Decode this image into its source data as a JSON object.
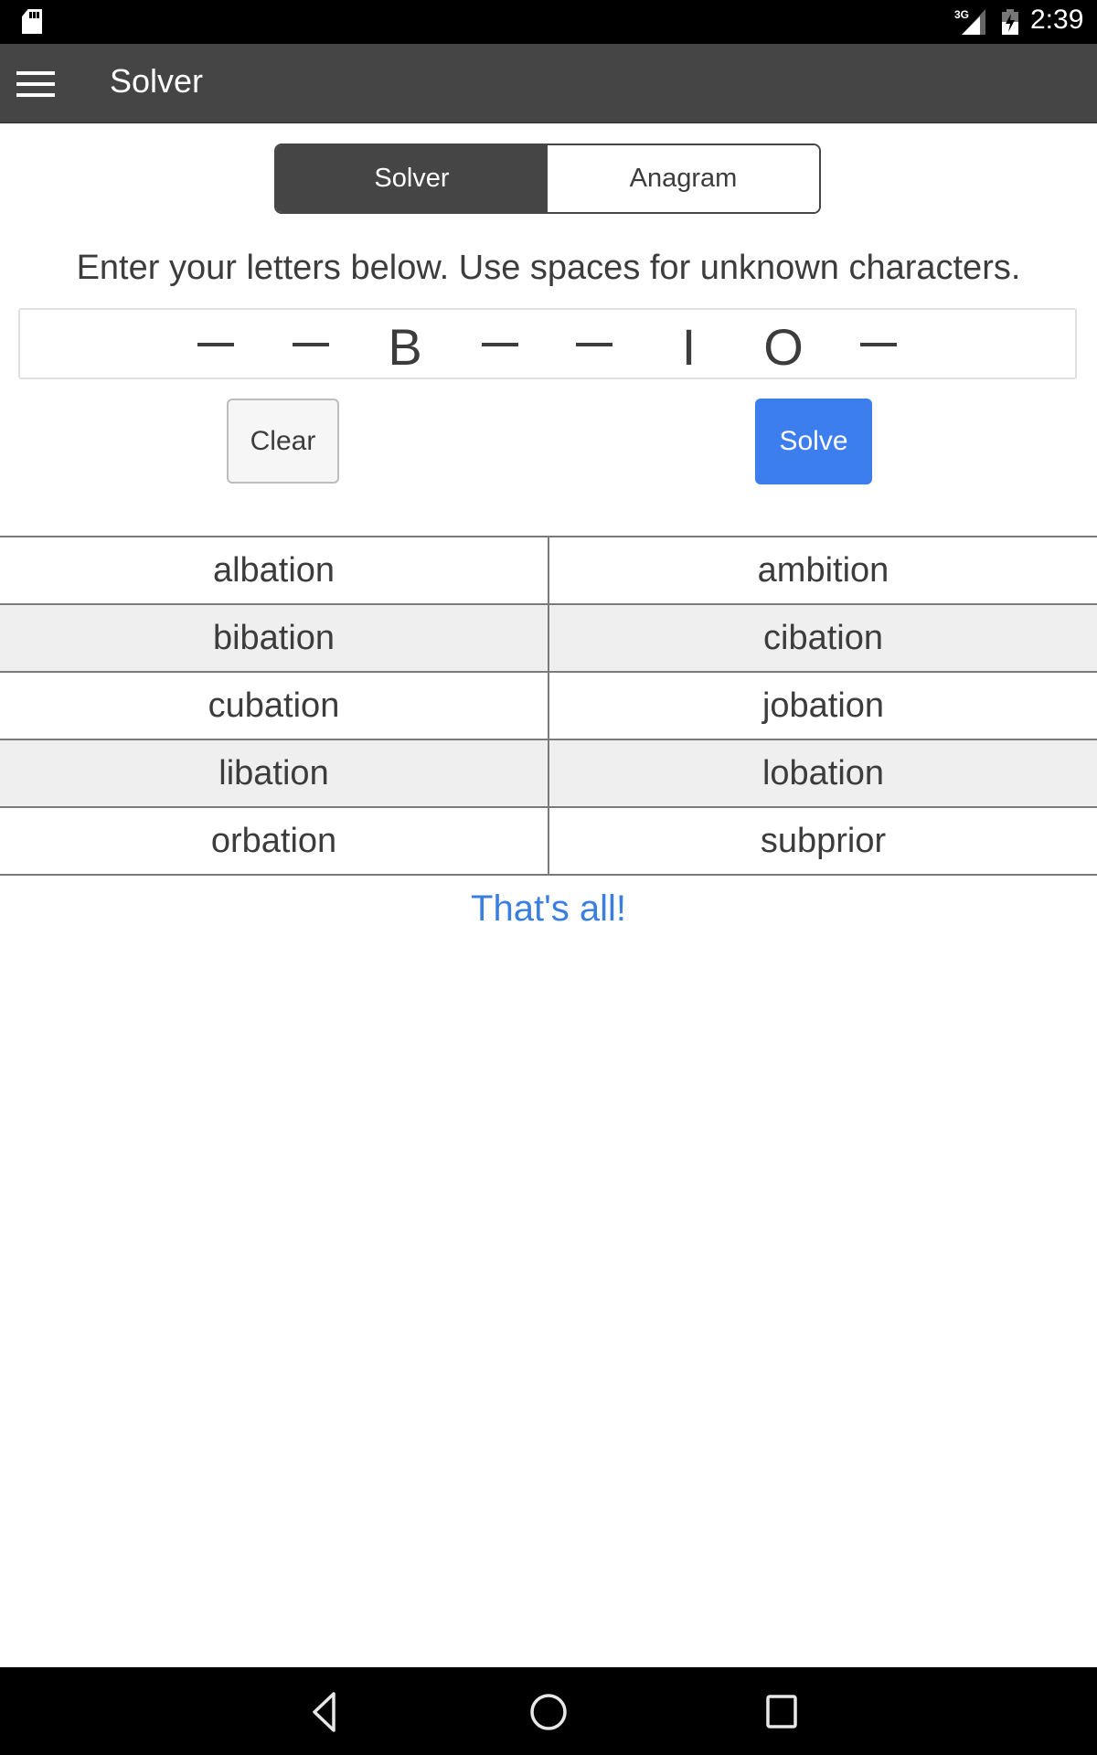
{
  "status_bar": {
    "left_icons": [
      "sd-card-icon"
    ],
    "network_label": "3G",
    "right_icons": [
      "signal-icon",
      "battery-charging-icon"
    ],
    "time": "2:39"
  },
  "app_bar": {
    "menu_icon": "hamburger-menu-icon",
    "title": "Solver"
  },
  "mode_tabs": [
    {
      "label": "Solver",
      "active": true
    },
    {
      "label": "Anagram",
      "active": false
    }
  ],
  "instructions": "Enter your letters below. Use spaces for unknown characters.",
  "letters_input": {
    "value": "  B  IO ",
    "characters": [
      "",
      "",
      "B",
      "",
      "",
      "I",
      "O",
      ""
    ]
  },
  "buttons": {
    "clear": "Clear",
    "solve": "Solve"
  },
  "results": [
    [
      "albation",
      "ambition"
    ],
    [
      "bibation",
      "cibation"
    ],
    [
      "cubation",
      "jobation"
    ],
    [
      "libation",
      "lobation"
    ],
    [
      "orbation",
      "subprior"
    ]
  ],
  "end_message": "That's all!",
  "nav_bar": {
    "icons": [
      "back-icon",
      "home-icon",
      "recents-icon"
    ]
  },
  "colors": {
    "app_bar": "#454545",
    "solve_button": "#3d7eef",
    "end_message": "#3a7fe0",
    "alt_row": "#efefef"
  }
}
